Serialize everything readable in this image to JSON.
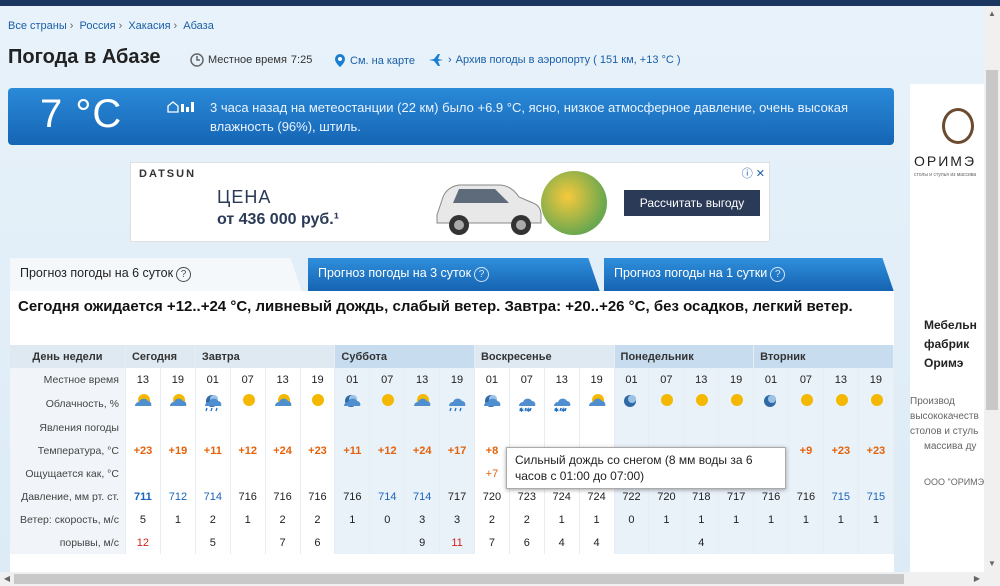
{
  "breadcrumb": [
    "Все страны",
    "Россия",
    "Хакасия",
    "Абаза"
  ],
  "page_title": "Погода в Абазе",
  "local_time_label": "Местное время",
  "local_time": "7:25",
  "map_link": "См. на карте",
  "archive_link": "Архив погоды в аэропорту ( 151 км, +13 °С )",
  "now": {
    "temp": "7 °C",
    "text": "3 часа назад на метеостанции (22 км) было +6.9 °С, ясно, низкое атмосферное давление, очень высокая влажность (96%), штиль."
  },
  "ad": {
    "brand": "DATSUN",
    "line1": "ЦЕНА",
    "line2": "от 436 000 руб.¹",
    "cta": "Рассчитать выгоду",
    "close": "ⓘ ✕"
  },
  "tabs": [
    "Прогноз погоды на 6 суток",
    "Прогноз погоды на 3 суток",
    "Прогноз погоды на 1 сутки"
  ],
  "summary": "Сегодня ожидается +12..+24 °С, ливневый дождь, слабый ветер. Завтра: +20..+26 °С, без осадков, легкий ветер.",
  "labels": {
    "day": "День недели",
    "time": "Местное время",
    "cloud": "Облачность, %",
    "phen": "Явления погоды",
    "temp": "Температура, °С",
    "feels": "Ощущается как, °С",
    "press": "Давление, мм рт. ст.",
    "wind": "Ветер: скорость, м/с",
    "gust": "порывы, м/с"
  },
  "days": [
    {
      "name": "Сегодня",
      "times": [
        "13",
        "19"
      ],
      "icons": [
        "partly-sun",
        "partly-sun"
      ],
      "temp": [
        "+23",
        "+19"
      ],
      "feels": [
        "",
        ""
      ],
      "press": [
        "711",
        "712"
      ],
      "wind": [
        "5",
        "1"
      ],
      "gust": [
        "12",
        ""
      ]
    },
    {
      "name": "Завтра",
      "times": [
        "01",
        "07",
        "13",
        "19"
      ],
      "icons": [
        "night-rain",
        "sun",
        "partly-sun",
        "sun"
      ],
      "temp": [
        "+11",
        "+12",
        "+24",
        "+23"
      ],
      "feels": [
        "",
        "",
        "",
        ""
      ],
      "press": [
        "714",
        "716",
        "716",
        "716"
      ],
      "wind": [
        "2",
        "1",
        "2",
        "2"
      ],
      "gust": [
        "5",
        "",
        "7",
        "6"
      ]
    },
    {
      "name": "Суббота",
      "times": [
        "01",
        "07",
        "13",
        "19"
      ],
      "icons": [
        "night-cloud",
        "sun",
        "partly-sun",
        "cloud-rain"
      ],
      "temp": [
        "+11",
        "+12",
        "+24",
        "+17"
      ],
      "feels": [
        "",
        "",
        "",
        ""
      ],
      "press": [
        "716",
        "714",
        "714",
        "717"
      ],
      "wind": [
        "1",
        "0",
        "3",
        "3"
      ],
      "gust": [
        "",
        "",
        "9",
        "11"
      ]
    },
    {
      "name": "Воскресенье",
      "times": [
        "01",
        "07",
        "13",
        "19"
      ],
      "icons": [
        "night-cloud",
        "snow-rain",
        "snow-rain",
        "partly-sun"
      ],
      "temp": [
        "+8",
        "",
        "",
        ""
      ],
      "feels": [
        "+7",
        "+2",
        "",
        ""
      ],
      "press": [
        "720",
        "723",
        "724",
        "724"
      ],
      "wind": [
        "2",
        "2",
        "1",
        "1"
      ],
      "gust": [
        "7",
        "6",
        "4",
        "4"
      ]
    },
    {
      "name": "Понедельник",
      "times": [
        "01",
        "07",
        "13",
        "19"
      ],
      "icons": [
        "night",
        "sun",
        "sun",
        "sun"
      ],
      "temp": [
        "",
        "",
        "",
        ""
      ],
      "feels": [
        "",
        "",
        "",
        ""
      ],
      "press": [
        "722",
        "720",
        "718",
        "717"
      ],
      "wind": [
        "0",
        "1",
        "1",
        "1"
      ],
      "gust": [
        "",
        "",
        "4",
        ""
      ]
    },
    {
      "name": "Вторник",
      "times": [
        "01",
        "07",
        "13",
        "19"
      ],
      "icons": [
        "night",
        "sun",
        "sun",
        "sun"
      ],
      "temp": [
        "",
        "+9",
        "+23",
        "+23"
      ],
      "feels": [
        "",
        "",
        "",
        ""
      ],
      "press": [
        "716",
        "716",
        "715",
        "715"
      ],
      "wind": [
        "1",
        "1",
        "1",
        "1"
      ],
      "gust": [
        "",
        "",
        "",
        ""
      ]
    }
  ],
  "tooltip": "Сильный дождь со снегом (8 мм воды за 6 часов с 01:00 до 07:00)",
  "side_ad": {
    "logo": "ОРИМЭ",
    "sub": "столы и стулья из массива",
    "title": [
      "Мебельн",
      "фабрик",
      "Оримэ"
    ],
    "text": [
      "Производ",
      "высококачеств",
      "столов и стуль",
      "массива ду"
    ],
    "org": "ООО \"ОРИМЭ\""
  },
  "colors": {
    "accent": "#1b64b8",
    "warm": "#e4620a",
    "gust": "#d2241f",
    "sun": "#f5b800"
  }
}
